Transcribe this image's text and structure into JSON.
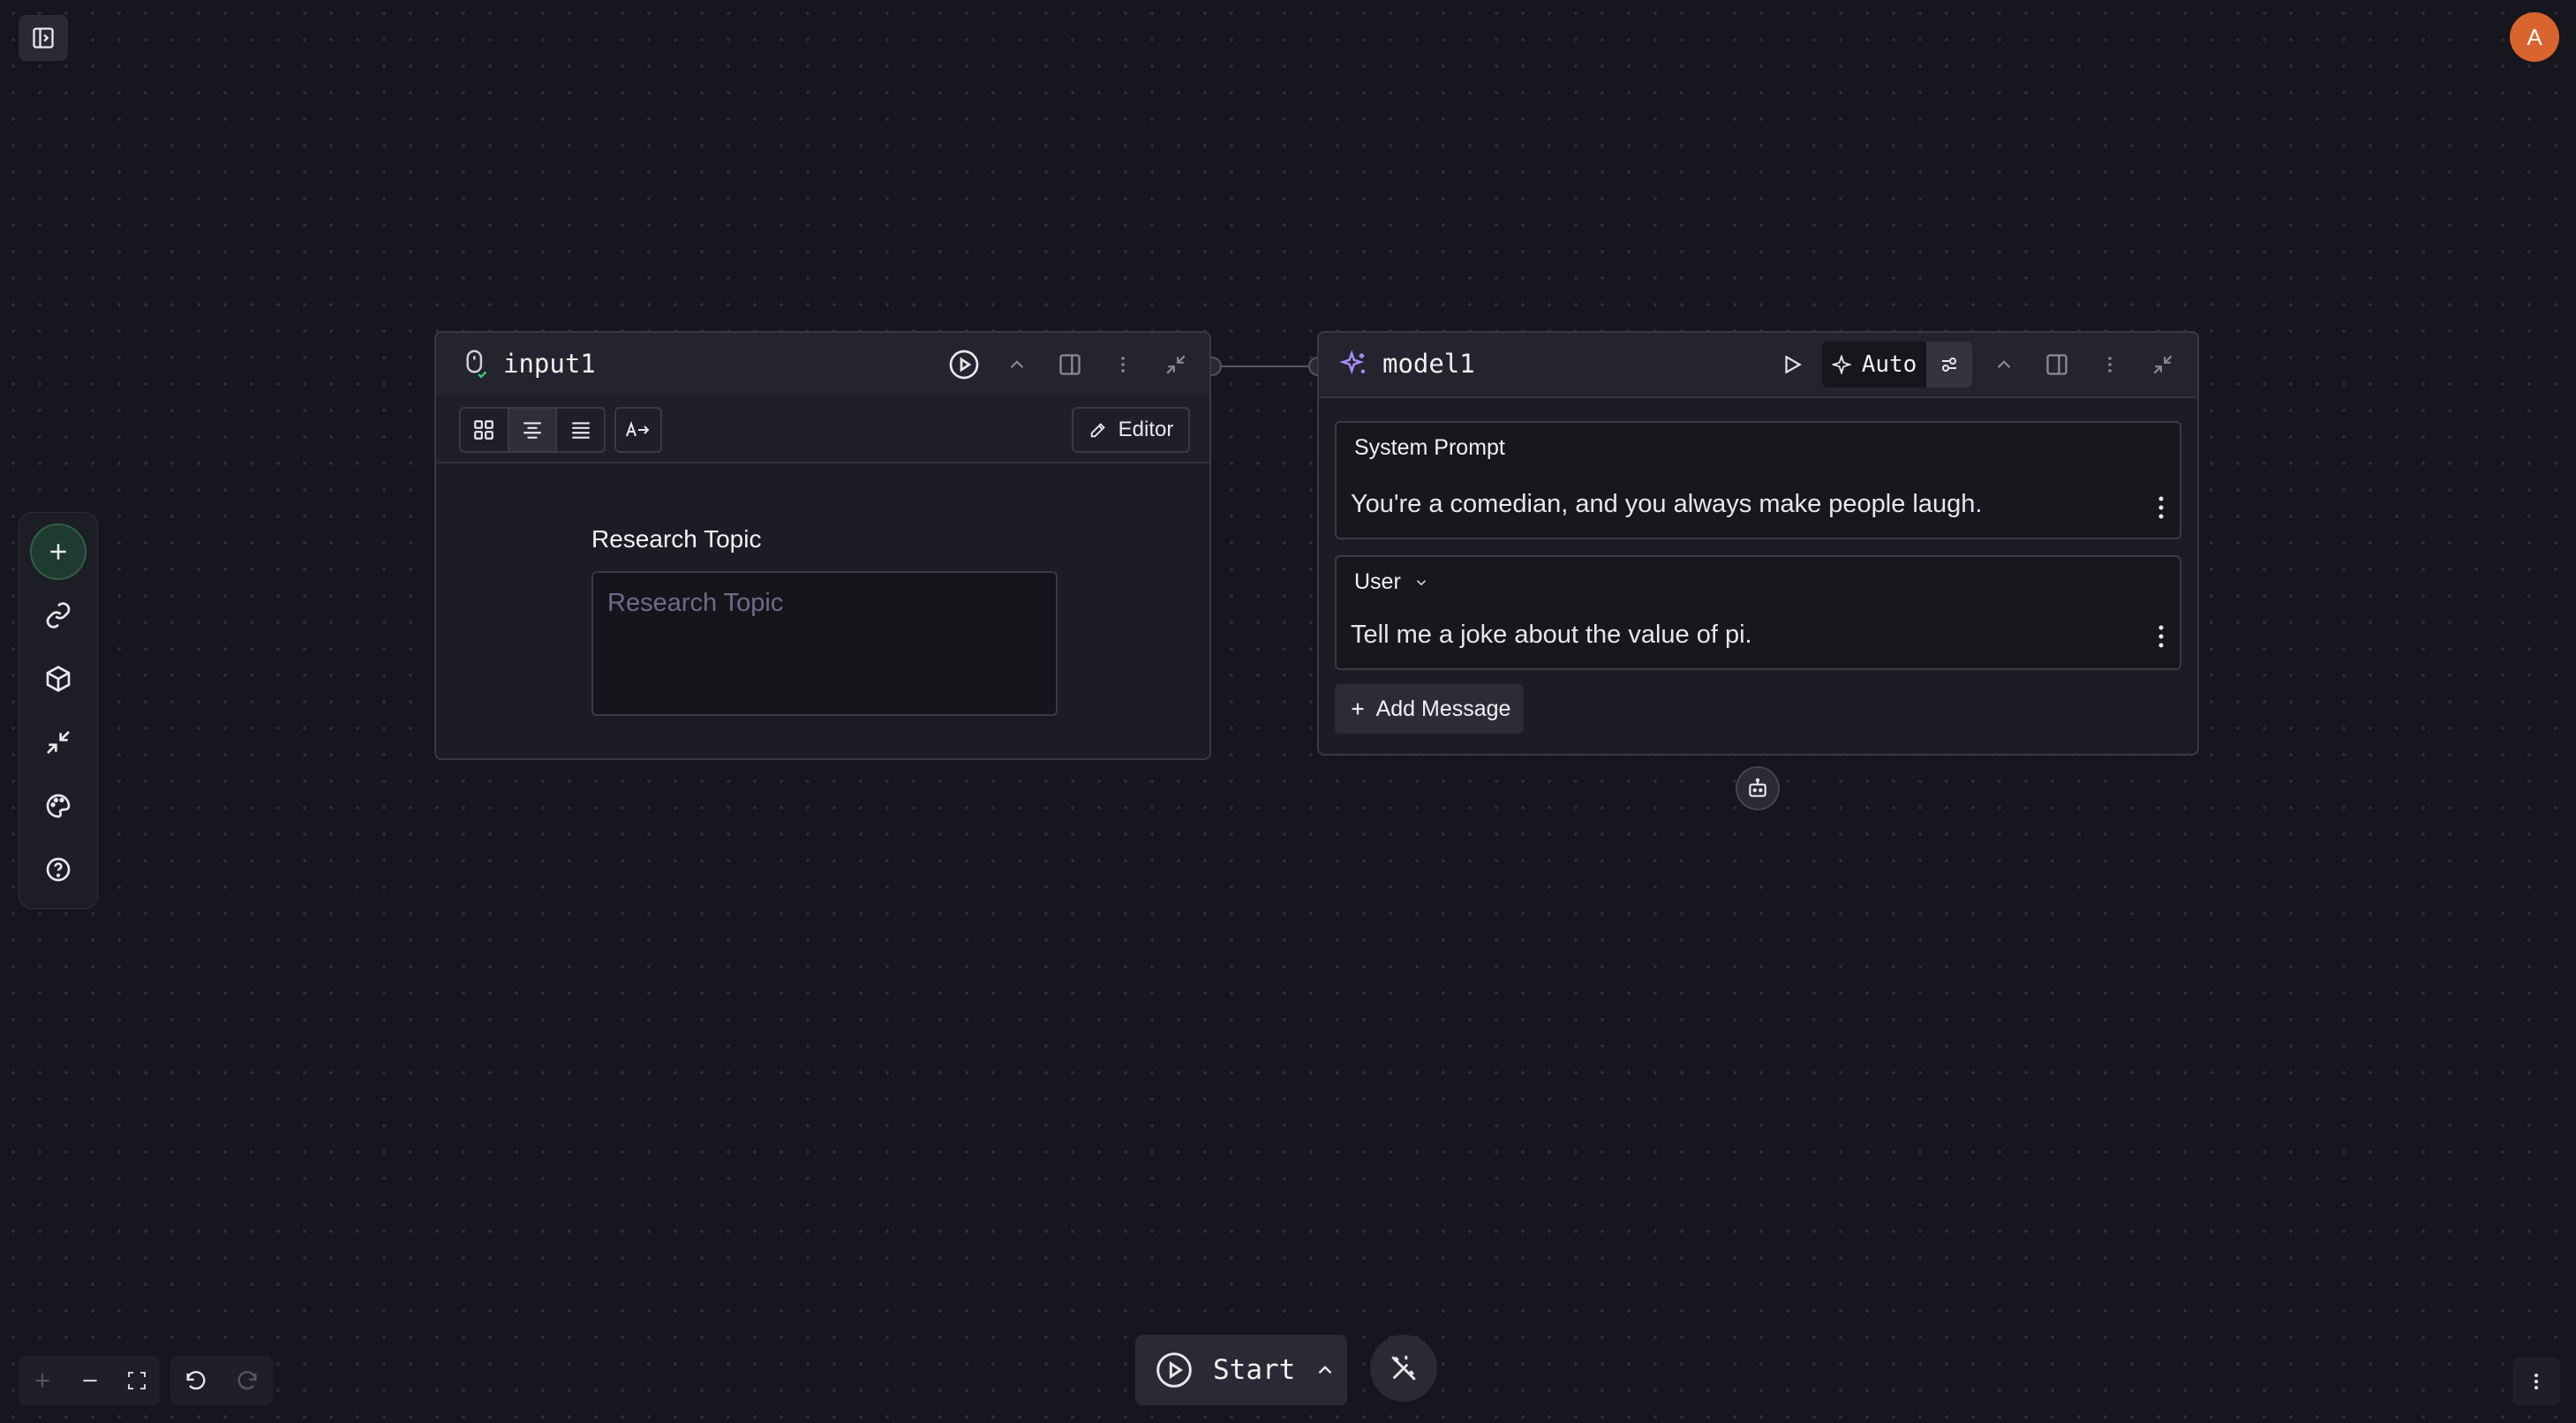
{
  "user": {
    "avatar_initial": "A",
    "avatar_color": "#d9642e"
  },
  "input_node": {
    "title": "input1",
    "editor_label": "Editor",
    "field_label": "Research Topic",
    "field_placeholder": "Research Topic",
    "field_value": ""
  },
  "model_node": {
    "title": "model1",
    "mode_label": "Auto",
    "system_prompt": {
      "role": "System Prompt",
      "text": "You're a comedian, and you always make people laugh."
    },
    "user_message": {
      "role": "User",
      "text": "Tell me a joke about the value of pi."
    },
    "add_message_label": "Add Message"
  },
  "run": {
    "start_label": "Start"
  },
  "icons": {
    "sidebar_toggle": "sidebar-toggle-icon",
    "toolbar": [
      "plus-icon",
      "link-icon",
      "cube-icon",
      "collapse-icon",
      "palette-icon",
      "help-icon"
    ],
    "agent": "robot-icon",
    "magic": "magic-wand-icon"
  },
  "colors": {
    "accent_green": "#2f5f48",
    "model_icon": "#a78bfa",
    "avatar": "#d9642e"
  }
}
